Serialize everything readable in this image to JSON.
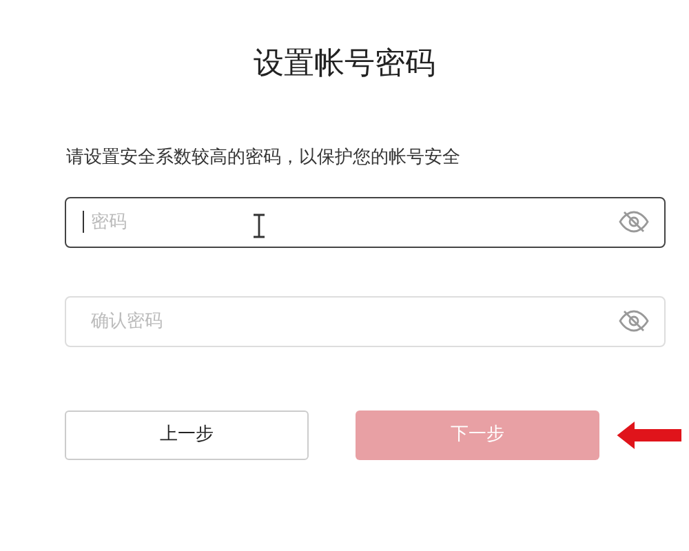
{
  "title": "设置帐号密码",
  "hint": "请设置安全系数较高的密码，以保护您的帐号安全",
  "fields": [
    {
      "placeholder": "密码",
      "focused": true
    },
    {
      "placeholder": "确认密码",
      "focused": false
    }
  ],
  "buttons": [
    {
      "label": "上一步",
      "kind": "secondary",
      "disabled": false
    },
    {
      "label": "下一步",
      "kind": "primary",
      "disabled": true
    }
  ]
}
